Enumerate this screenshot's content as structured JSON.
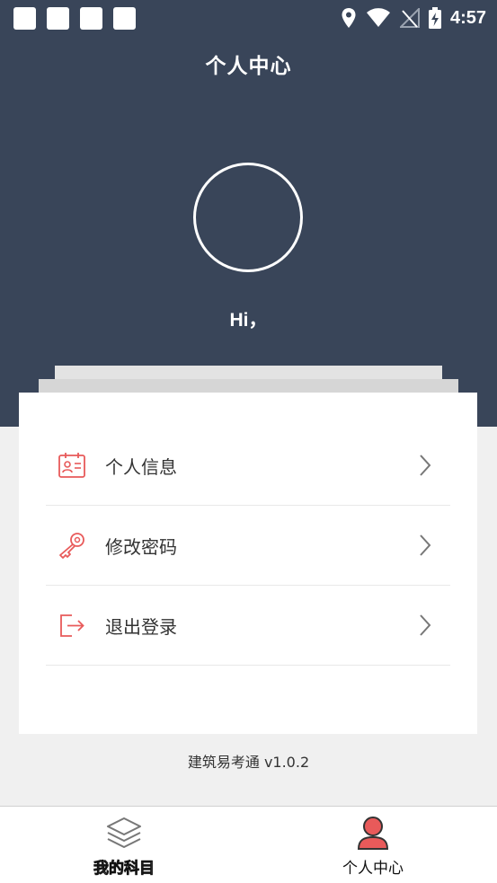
{
  "status_bar": {
    "time": "4:57",
    "icons": [
      "location-icon",
      "wifi-icon",
      "no-signal-icon",
      "battery-charging-icon"
    ]
  },
  "header": {
    "title": "个人中心",
    "greeting": "Hi，"
  },
  "menu": {
    "items": [
      {
        "label": "个人信息",
        "icon": "id-card-icon"
      },
      {
        "label": "修改密码",
        "icon": "key-icon"
      },
      {
        "label": "退出登录",
        "icon": "logout-icon"
      }
    ]
  },
  "footer": {
    "version": "建筑易考通 v1.0.2"
  },
  "tabbar": {
    "tabs": [
      {
        "label": "我的科目",
        "icon": "layers-icon",
        "active": false
      },
      {
        "label": "个人中心",
        "icon": "user-icon",
        "active": true
      }
    ]
  },
  "colors": {
    "header_bg": "#394559",
    "accent_red": "#e85a5a",
    "page_bg": "#f0f0f0"
  }
}
